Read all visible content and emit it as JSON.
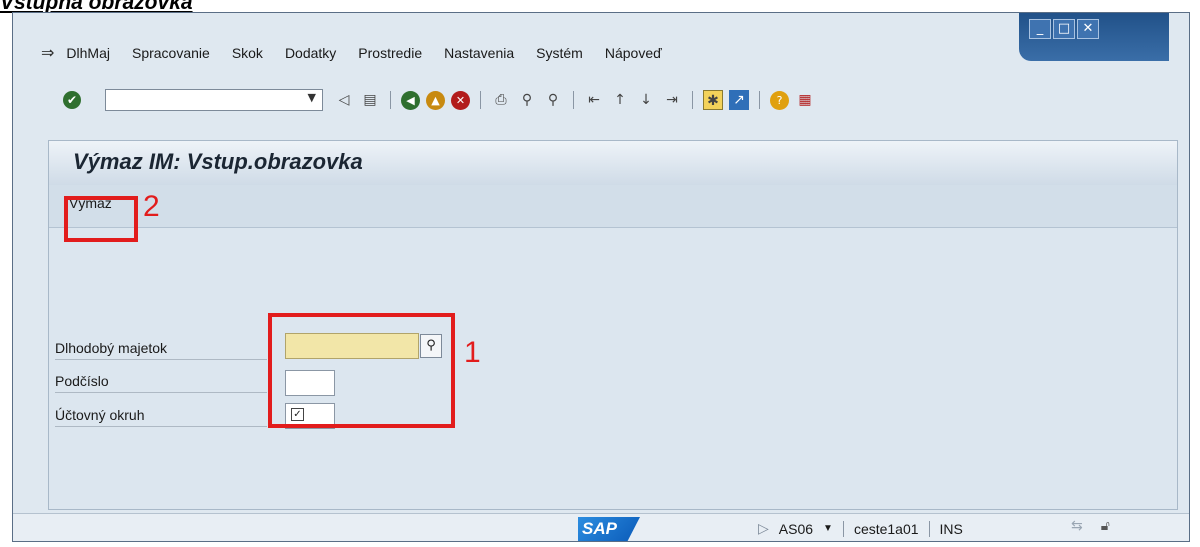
{
  "caption": "Vstupná obrazovka",
  "window": {
    "controls": {
      "minimize": "_",
      "maximize": "□",
      "close": "✕"
    }
  },
  "menubar": {
    "items": [
      "DlhMaj",
      "Spracovanie",
      "Skok",
      "Dodatky",
      "Prostredie",
      "Nastavenia",
      "Systém",
      "Nápoveď"
    ]
  },
  "toolbar": {
    "command_value": "",
    "icons": [
      "enter-icon",
      "back-arrow-icon",
      "save-icon",
      "back-icon",
      "exit-icon",
      "cancel-icon",
      "print-icon",
      "find-icon",
      "find-next-icon",
      "first-page-icon",
      "previous-page-icon",
      "next-page-icon",
      "last-page-icon",
      "create-session-icon",
      "shortcut-icon",
      "help-icon",
      "layout-menu-icon"
    ]
  },
  "screen": {
    "title": "Výmaz IM: Vstup.obrazovka",
    "app_button": "Výmaz"
  },
  "form": {
    "fields": [
      {
        "label": "Dlhodobý majetok",
        "value": ""
      },
      {
        "label": "Podčíslo",
        "value": ""
      },
      {
        "label": "Účtovný okruh",
        "value": ""
      }
    ]
  },
  "annotations": {
    "marker_1": "1",
    "marker_2": "2"
  },
  "statusbar": {
    "logo": "SAP",
    "transaction": "AS06",
    "server": "ceste1a01",
    "mode": "INS"
  },
  "colors": {
    "annotation": "#e21c1c",
    "required_field": "#f2e6a8",
    "background": "#dce6ef"
  }
}
